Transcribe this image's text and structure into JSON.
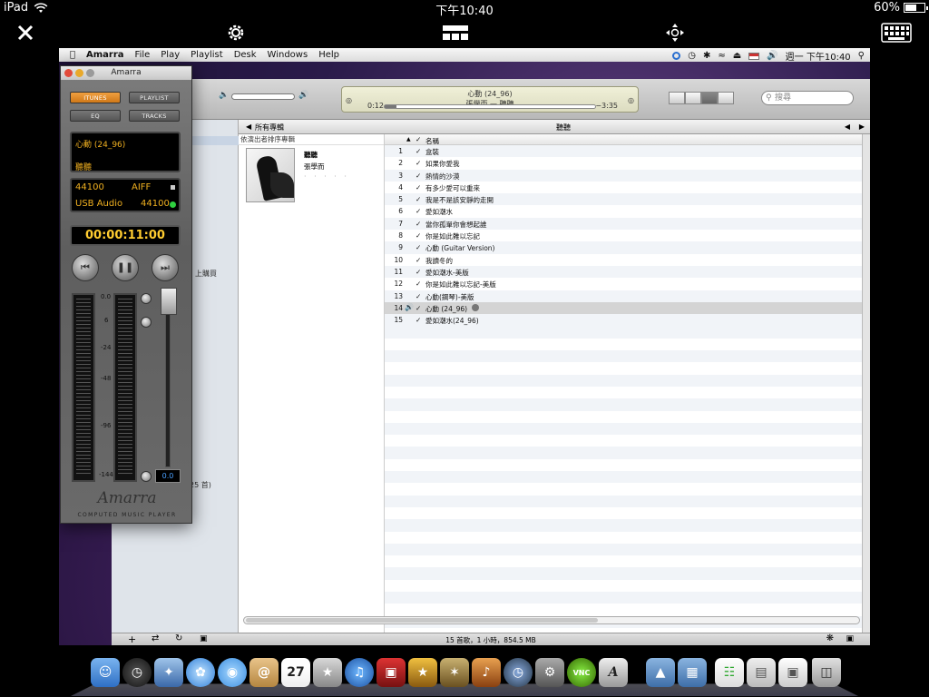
{
  "ipad": {
    "carrier": "iPad",
    "time": "下午10:40",
    "battery": "60%",
    "battery_level": 0.6
  },
  "mac_menubar": {
    "app": "Amarra",
    "menus": [
      "File",
      "Play",
      "Playlist",
      "Desk",
      "Windows",
      "Help"
    ],
    "clock": "週一 下午10:40"
  },
  "itunes": {
    "now_playing_title": "心動 (24_96)",
    "now_playing_sub": "張學而 — 聽聽",
    "elapsed": "0:12",
    "remaining": "−3:35",
    "progress": 0.055,
    "search_placeholder": "搜尋",
    "browser_left": "所有專輯",
    "browser_center": "聽聽",
    "album_pane_header": "依演出者排序專輯",
    "album_title": "聽聽",
    "album_artist": "張學而",
    "album_rating": "· · · · ·",
    "col_name": "名稱",
    "checkmark": "✓",
    "tracks": [
      {
        "n": "1",
        "title": "盒裝"
      },
      {
        "n": "2",
        "title": "如果你愛我"
      },
      {
        "n": "3",
        "title": "熱情的沙漠"
      },
      {
        "n": "4",
        "title": "有多少愛可以重來"
      },
      {
        "n": "5",
        "title": "我是不是該安靜的走開"
      },
      {
        "n": "6",
        "title": "愛如潮水"
      },
      {
        "n": "7",
        "title": "當你孤單你會想起誰"
      },
      {
        "n": "8",
        "title": "你是如此難以忘記"
      },
      {
        "n": "9",
        "title": "心動 (Guitar Version)"
      },
      {
        "n": "10",
        "title": "我讀冬的"
      },
      {
        "n": "11",
        "title": "愛如潮水-美版"
      },
      {
        "n": "12",
        "title": "你是如此難以忘記-美版"
      },
      {
        "n": "13",
        "title": "心動(鋼琴)-美版"
      },
      {
        "n": "14",
        "title": "心動 (24_96)",
        "playing": true
      },
      {
        "n": "15",
        "title": "愛如潮水(24_96)"
      }
    ],
    "status": "15 首歌，1 小時，854.5 MB",
    "sidebar_frag_1": "上購買",
    "sidebar_frag_2": "25 首)"
  },
  "amarra": {
    "title": "Amarra",
    "btn_itunes": "ITUNES",
    "btn_playlist": "PLAYLIST",
    "btn_eq": "EQ",
    "btn_tracks": "TRACKS",
    "track": "心動 (24_96)",
    "artist": "聽聽",
    "rate": "44100",
    "format": "AIFF",
    "device": "USB Audio",
    "device_rate": "44100",
    "timecode": "00:00:11:00",
    "scale": [
      "0.0",
      "6",
      "-24",
      "-48",
      "-96",
      "-144"
    ],
    "fader_value": "0.0",
    "logo": "Amarra",
    "tagline": "COMPUTED MUSIC PLAYER"
  }
}
